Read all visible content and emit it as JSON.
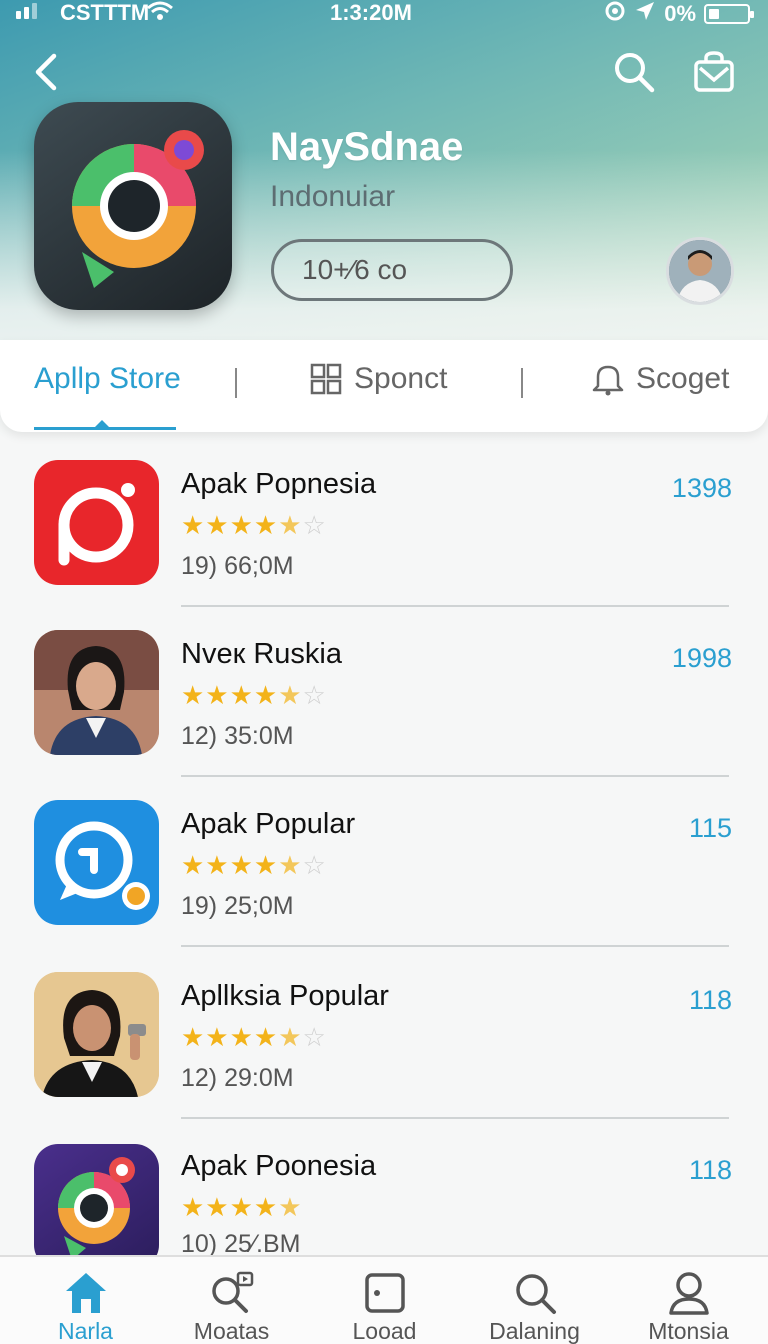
{
  "status_bar": {
    "carrier": "CSTTTM",
    "time": "1:3:20M",
    "battery": "0%",
    "icons": [
      "signal-icon",
      "wifi-icon",
      "sync-icon",
      "location-icon",
      "battery-icon"
    ]
  },
  "header": {
    "icons": [
      "back-icon",
      "search-icon",
      "bag-icon"
    ],
    "app_title": "NaySdnae",
    "app_subtitle": "Indonuiar",
    "pill_text": "10+⁄6 co",
    "avatar": "avatar"
  },
  "tabs": [
    {
      "label": "Apllp Store",
      "icon": "",
      "active": true
    },
    {
      "label": "Sponct",
      "icon": "grid-icon",
      "active": false
    },
    {
      "label": "Scoget",
      "icon": "bell-icon",
      "active": false
    }
  ],
  "list": [
    {
      "name": "Apak Popnesia",
      "rating": 4.5,
      "meta": "19) 66;0M",
      "count": "1398",
      "icon": "red-app-icon"
    },
    {
      "name": "Nveк Ruskia",
      "rating": 4.5,
      "meta": "12) 35:0M",
      "count": "1998",
      "icon": "woman-photo-icon"
    },
    {
      "name": "Apak Popular",
      "rating": 4.5,
      "meta": "19) 25;0M",
      "count": "115",
      "icon": "blue-chat-app-icon"
    },
    {
      "name": "Apllksia Popular",
      "rating": 4.5,
      "meta": "12) 29:0M",
      "count": "118",
      "icon": "woman-microphone-photo-icon"
    },
    {
      "name": "Apak Poonesia",
      "rating": 4.5,
      "meta": "10) 25⁄.BM",
      "count": "118",
      "icon": "purple-maps-app-icon"
    }
  ],
  "bottom_nav": [
    {
      "label": "Narla",
      "icon": "home-icon",
      "active": true
    },
    {
      "label": "Moatas",
      "icon": "search-image-icon",
      "active": false
    },
    {
      "label": "Loоad",
      "icon": "square-icon",
      "active": false
    },
    {
      "label": "Dalaning",
      "icon": "search-icon",
      "active": false
    },
    {
      "label": "Mtonsia",
      "icon": "person-icon",
      "active": false
    }
  ],
  "colors": {
    "accent": "#2a9fd0",
    "star": "#f3b31a",
    "header_gradient_start": "#3d9ab0",
    "header_gradient_end": "#c9e6c8"
  }
}
